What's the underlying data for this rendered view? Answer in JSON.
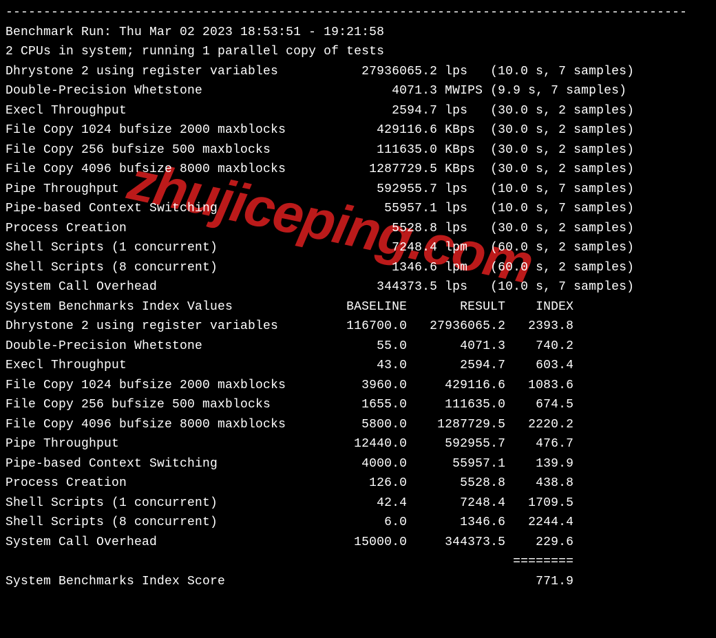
{
  "watermark": "zhujiceping.com",
  "divider_top": "------------------------------------------------------------------------------------------",
  "run_header": "Benchmark Run: Thu Mar 02 2023 18:53:51 - 19:21:58",
  "cpu_header": "2 CPUs in system; running 1 parallel copy of tests",
  "results": [
    {
      "name": "Dhrystone 2 using register variables",
      "value": "27936065.2",
      "unit": "lps",
      "time": "10.0",
      "samples": "7"
    },
    {
      "name": "Double-Precision Whetstone",
      "value": "4071.3",
      "unit": "MWIPS",
      "time": "9.9",
      "samples": "7"
    },
    {
      "name": "Execl Throughput",
      "value": "2594.7",
      "unit": "lps",
      "time": "30.0",
      "samples": "2"
    },
    {
      "name": "File Copy 1024 bufsize 2000 maxblocks",
      "value": "429116.6",
      "unit": "KBps",
      "time": "30.0",
      "samples": "2"
    },
    {
      "name": "File Copy 256 bufsize 500 maxblocks",
      "value": "111635.0",
      "unit": "KBps",
      "time": "30.0",
      "samples": "2"
    },
    {
      "name": "File Copy 4096 bufsize 8000 maxblocks",
      "value": "1287729.5",
      "unit": "KBps",
      "time": "30.0",
      "samples": "2"
    },
    {
      "name": "Pipe Throughput",
      "value": "592955.7",
      "unit": "lps",
      "time": "10.0",
      "samples": "7"
    },
    {
      "name": "Pipe-based Context Switching",
      "value": "55957.1",
      "unit": "lps",
      "time": "10.0",
      "samples": "7"
    },
    {
      "name": "Process Creation",
      "value": "5528.8",
      "unit": "lps",
      "time": "30.0",
      "samples": "2"
    },
    {
      "name": "Shell Scripts (1 concurrent)",
      "value": "7248.4",
      "unit": "lpm",
      "time": "60.0",
      "samples": "2"
    },
    {
      "name": "Shell Scripts (8 concurrent)",
      "value": "1346.6",
      "unit": "lpm",
      "time": "60.0",
      "samples": "2"
    },
    {
      "name": "System Call Overhead",
      "value": "344373.5",
      "unit": "lps",
      "time": "10.0",
      "samples": "7"
    }
  ],
  "index_header": "System Benchmarks Index Values               BASELINE       RESULT    INDEX",
  "index": [
    {
      "name": "Dhrystone 2 using register variables",
      "baseline": "116700.0",
      "result": "27936065.2",
      "index": "2393.8"
    },
    {
      "name": "Double-Precision Whetstone",
      "baseline": "55.0",
      "result": "4071.3",
      "index": "740.2"
    },
    {
      "name": "Execl Throughput",
      "baseline": "43.0",
      "result": "2594.7",
      "index": "603.4"
    },
    {
      "name": "File Copy 1024 bufsize 2000 maxblocks",
      "baseline": "3960.0",
      "result": "429116.6",
      "index": "1083.6"
    },
    {
      "name": "File Copy 256 bufsize 500 maxblocks",
      "baseline": "1655.0",
      "result": "111635.0",
      "index": "674.5"
    },
    {
      "name": "File Copy 4096 bufsize 8000 maxblocks",
      "baseline": "5800.0",
      "result": "1287729.5",
      "index": "2220.2"
    },
    {
      "name": "Pipe Throughput",
      "baseline": "12440.0",
      "result": "592955.7",
      "index": "476.7"
    },
    {
      "name": "Pipe-based Context Switching",
      "baseline": "4000.0",
      "result": "55957.1",
      "index": "139.9"
    },
    {
      "name": "Process Creation",
      "baseline": "126.0",
      "result": "5528.8",
      "index": "438.8"
    },
    {
      "name": "Shell Scripts (1 concurrent)",
      "baseline": "42.4",
      "result": "7248.4",
      "index": "1709.5"
    },
    {
      "name": "Shell Scripts (8 concurrent)",
      "baseline": "6.0",
      "result": "1346.6",
      "index": "2244.4"
    },
    {
      "name": "System Call Overhead",
      "baseline": "15000.0",
      "result": "344373.5",
      "index": "229.6"
    }
  ],
  "index_rule": "                                                                   ========",
  "score_label": "System Benchmarks Index Score",
  "score_value": "771.9"
}
